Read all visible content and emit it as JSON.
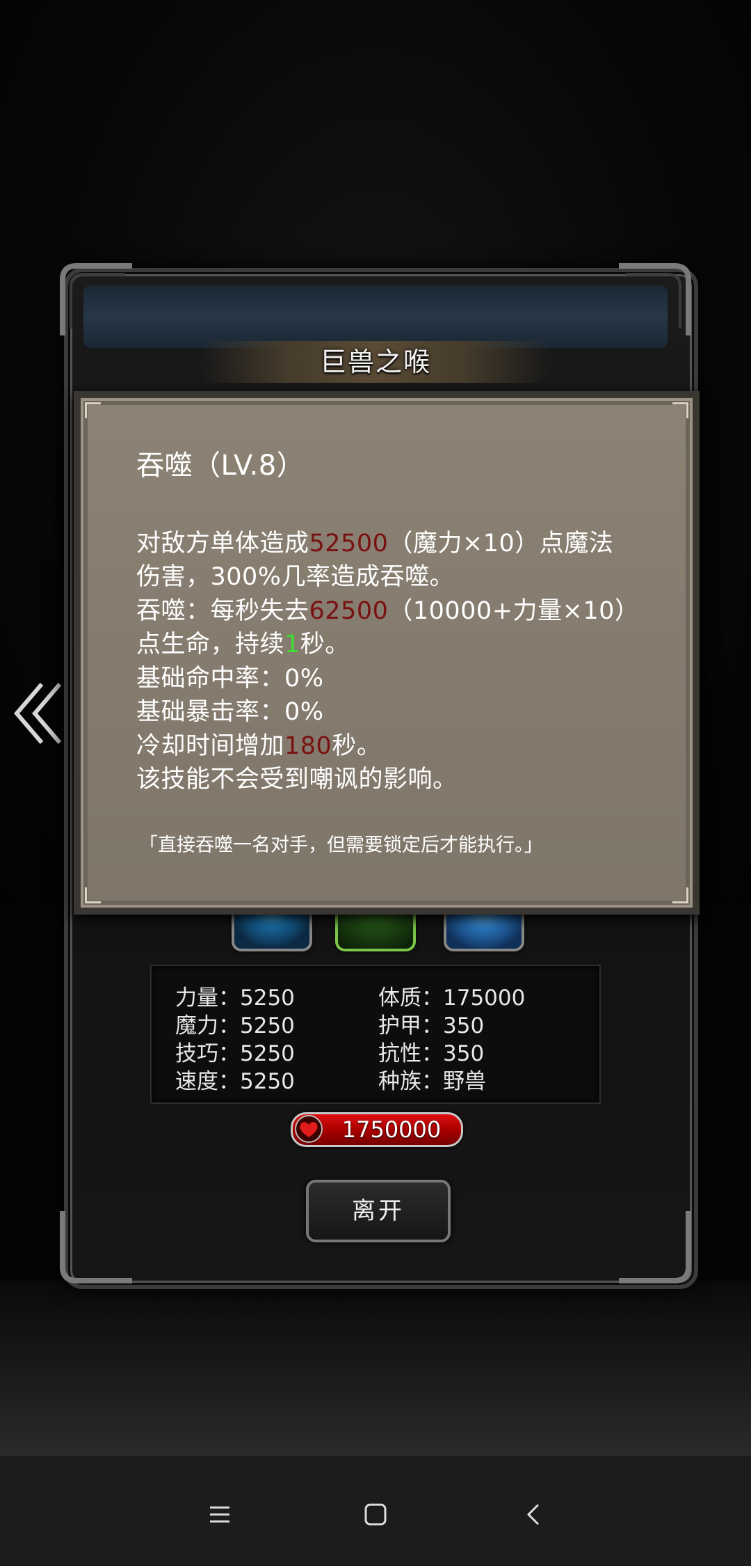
{
  "dialog": {
    "title": "巨兽之喉"
  },
  "skill_tooltip": {
    "name_line": "吞噬（LV.8）",
    "desc_1_pre": "对敌方单体造成",
    "desc_1_value": "52500",
    "desc_1_post": "（魔力×10）点魔法",
    "desc_2": "伤害，300%几率造成吞噬。",
    "desc_3_pre": "吞噬：每秒失去",
    "desc_3_value": "62500",
    "desc_3_post": "（10000+力量×10）",
    "desc_4_pre": "点生命，持续",
    "desc_4_value": "1",
    "desc_4_post": "秒。",
    "hit_rate": "基础命中率：0%",
    "crit_rate": "基础暴击率：0%",
    "cooldown_pre": "冷却时间增加",
    "cooldown_value": "180",
    "cooldown_post": "秒。",
    "taunt_note": "该技能不会受到嘲讽的影响。",
    "flavor_quote": "「直接吞噬一名对手，但需要锁定后才能执行。」",
    "value_color": "#7a1111",
    "duration_color": "#3dde34"
  },
  "skills": [
    {
      "icon": "eye-skill-icon"
    },
    {
      "icon": "devour-skill-icon",
      "selected": true
    },
    {
      "icon": "wing-skill-icon"
    }
  ],
  "stats": {
    "strength": "力量：5250",
    "magic": "魔力：5250",
    "skill": "技巧：5250",
    "speed": "速度：5250",
    "constitution": "体质：175000",
    "armor": "护甲：350",
    "resistance": "抗性：350",
    "race": "种族：野兽"
  },
  "hp": {
    "value": "1750000",
    "bar_color": "#aa0000"
  },
  "buttons": {
    "leave": "离开"
  }
}
